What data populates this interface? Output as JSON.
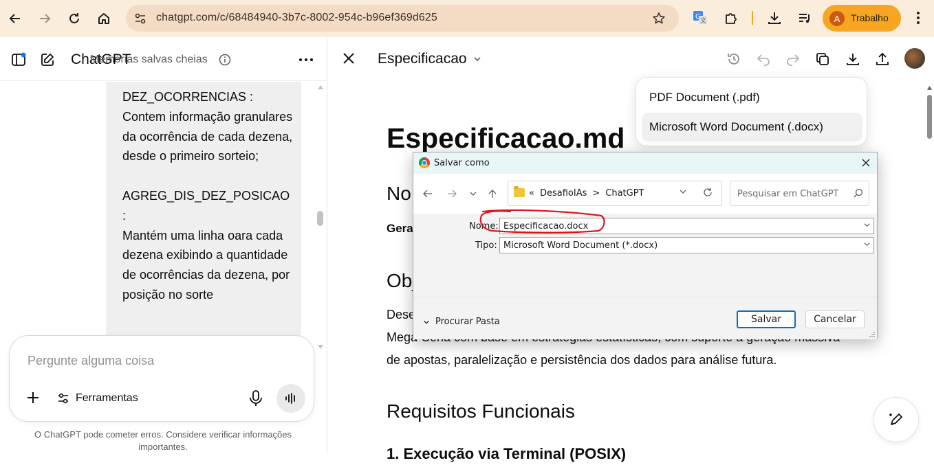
{
  "browser": {
    "url": "chatgpt.com/c/68484940-3b7c-8002-954c-b96ef369d625",
    "profile_initial": "A",
    "profile_name": "Trabalho"
  },
  "sidebar": {
    "app_title": "ChatGPT",
    "memory_status": "Memórias salvas cheias",
    "message_text": "DEZ_OCORRENCIAS :\nContem informação granulares da ocorrência de cada dezena, desde o primeiro sorteio;\n\nAGREG_DIS_DEZ_POSICAO :\nMantém uma linha oara cada dezena exibindo a quantidade de ocorrências da dezena, por posição no sorte",
    "composer_placeholder": "Pergunte alguma coisa",
    "tools_label": "Ferramentas",
    "disclaimer": "O ChatGPT pode cometer erros. Considere verificar informações importantes."
  },
  "canvas": {
    "title": "Especificacao",
    "doc_h1": "Especificacao.md",
    "h2_partial_1": "No",
    "bold_partial": "Gera",
    "h2_partial_2": "Obj",
    "para_line1": "Dese",
    "para_line2": "Mega-Sena com base em estratégias estatísticas, com suporte à geração massiva",
    "para_line3": "de apostas, paralelização e persistência dos dados para análise futura.",
    "h2_requisitos": "Requisitos Funcionais",
    "list_item_partial": "1. Execução via Terminal (POSIX)"
  },
  "download_menu": {
    "items": [
      {
        "label": "PDF Document (.pdf)"
      },
      {
        "label": "Microsoft Word Document (.docx)"
      }
    ]
  },
  "save_dialog": {
    "title": "Salvar como",
    "breadcrumb": [
      "«",
      "DesafioIAs",
      ">",
      "ChatGPT"
    ],
    "search_placeholder": "Pesquisar em ChatGPT",
    "name_label": "Nome:",
    "name_value": "Especificacao.docx",
    "type_label": "Tipo:",
    "type_value": "Microsoft Word Document (*.docx)",
    "browse_label": "Procurar Pasta",
    "save_label": "Salvar",
    "cancel_label": "Cancelar"
  },
  "colors": {
    "topbar": "#fbeddc",
    "urlbar": "#f3dcc3",
    "profile": "#f6a623",
    "accent_blue": "#0f6cbd",
    "annotation_red": "#e0141e"
  }
}
